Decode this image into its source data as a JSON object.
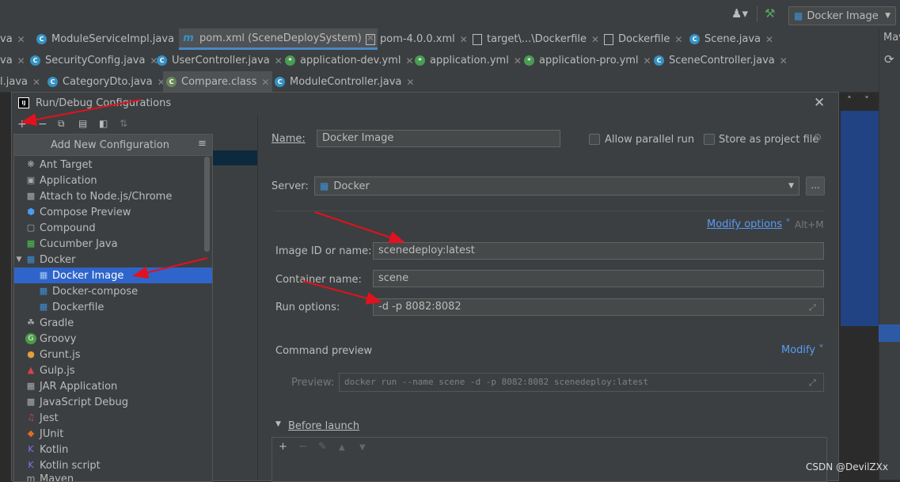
{
  "toolbar": {
    "run_config": "Docker Image",
    "icons": [
      "user-icon",
      "hammer-icon",
      "docker-icon",
      "chevron-down-icon"
    ]
  },
  "tabs": {
    "row1": [
      {
        "label": "va"
      },
      {
        "label": "ModuleServiceImpl.java"
      },
      {
        "label": "pom.xml (SceneDeploySystem)"
      },
      {
        "label": "pom-4.0.0.xml"
      },
      {
        "label": "target\\...\\Dockerfile"
      },
      {
        "label": "Dockerfile"
      },
      {
        "label": "Scene.java"
      }
    ],
    "row2": [
      {
        "label": "va"
      },
      {
        "label": "SecurityConfig.java"
      },
      {
        "label": "UserController.java"
      },
      {
        "label": "application-dev.yml"
      },
      {
        "label": "application.yml"
      },
      {
        "label": "application-pro.yml"
      },
      {
        "label": "SceneController.java"
      }
    ],
    "row3": [
      {
        "label": "l.java"
      },
      {
        "label": "CategoryDto.java"
      },
      {
        "label": "Compare.class"
      },
      {
        "label": "ModuleController.java"
      }
    ]
  },
  "right_panel": {
    "title": "Mav"
  },
  "dialog": {
    "title": "Run/Debug Configurations",
    "popup": {
      "header": "Add New Configuration",
      "items": [
        {
          "label": "Ant Target",
          "icon": "ant-icon"
        },
        {
          "label": "Application",
          "icon": "application-icon"
        },
        {
          "label": "Attach to Node.js/Chrome",
          "icon": "nodejs-icon"
        },
        {
          "label": "Compose Preview",
          "icon": "compose-icon"
        },
        {
          "label": "Compound",
          "icon": "compound-icon"
        },
        {
          "label": "Cucumber Java",
          "icon": "cucumber-icon"
        },
        {
          "label": "Docker",
          "icon": "docker-icon",
          "expanded": true
        },
        {
          "label": "Docker Image",
          "icon": "docker-icon",
          "selected": true,
          "child": true
        },
        {
          "label": "Docker-compose",
          "icon": "docker-icon",
          "child": true
        },
        {
          "label": "Dockerfile",
          "icon": "docker-icon",
          "child": true
        },
        {
          "label": "Gradle",
          "icon": "gradle-icon"
        },
        {
          "label": "Groovy",
          "icon": "groovy-icon"
        },
        {
          "label": "Grunt.js",
          "icon": "grunt-icon"
        },
        {
          "label": "Gulp.js",
          "icon": "gulp-icon"
        },
        {
          "label": "JAR Application",
          "icon": "jar-icon"
        },
        {
          "label": "JavaScript Debug",
          "icon": "js-debug-icon"
        },
        {
          "label": "Jest",
          "icon": "jest-icon"
        },
        {
          "label": "JUnit",
          "icon": "junit-icon"
        },
        {
          "label": "Kotlin",
          "icon": "kotlin-icon"
        },
        {
          "label": "Kotlin script",
          "icon": "kotlin-icon"
        },
        {
          "label": "Maven",
          "icon": "maven-icon"
        }
      ]
    },
    "form": {
      "name_label": "Name:",
      "name_value": "Docker Image",
      "allow_parallel": "Allow parallel run",
      "store_project": "Store as project file",
      "server_label": "Server:",
      "server_value": "Docker",
      "modify_options": "Modify options",
      "modify_shortcut": "Alt+M",
      "image_label": "Image ID or name:",
      "image_value": "scenedeploy:latest",
      "container_label": "Container name:",
      "container_value": "scene",
      "run_options_label": "Run options:",
      "run_options_value": "-d -p 8082:8082",
      "command_preview": "Command preview",
      "modify": "Modify",
      "preview_label": "Preview:",
      "preview_value": "docker run --name scene -d -p 8082:8082 scenedeploy:latest",
      "before_launch": "Before launch"
    }
  },
  "watermark": "CSDN @DevilZXx",
  "colors": {
    "background": "#2b2b2b",
    "panel": "#3c3f41",
    "selection": "#2f65ca",
    "link": "#589df6",
    "annotation_arrow": "#e0121e",
    "docker_blue": "#3d8fd6"
  }
}
